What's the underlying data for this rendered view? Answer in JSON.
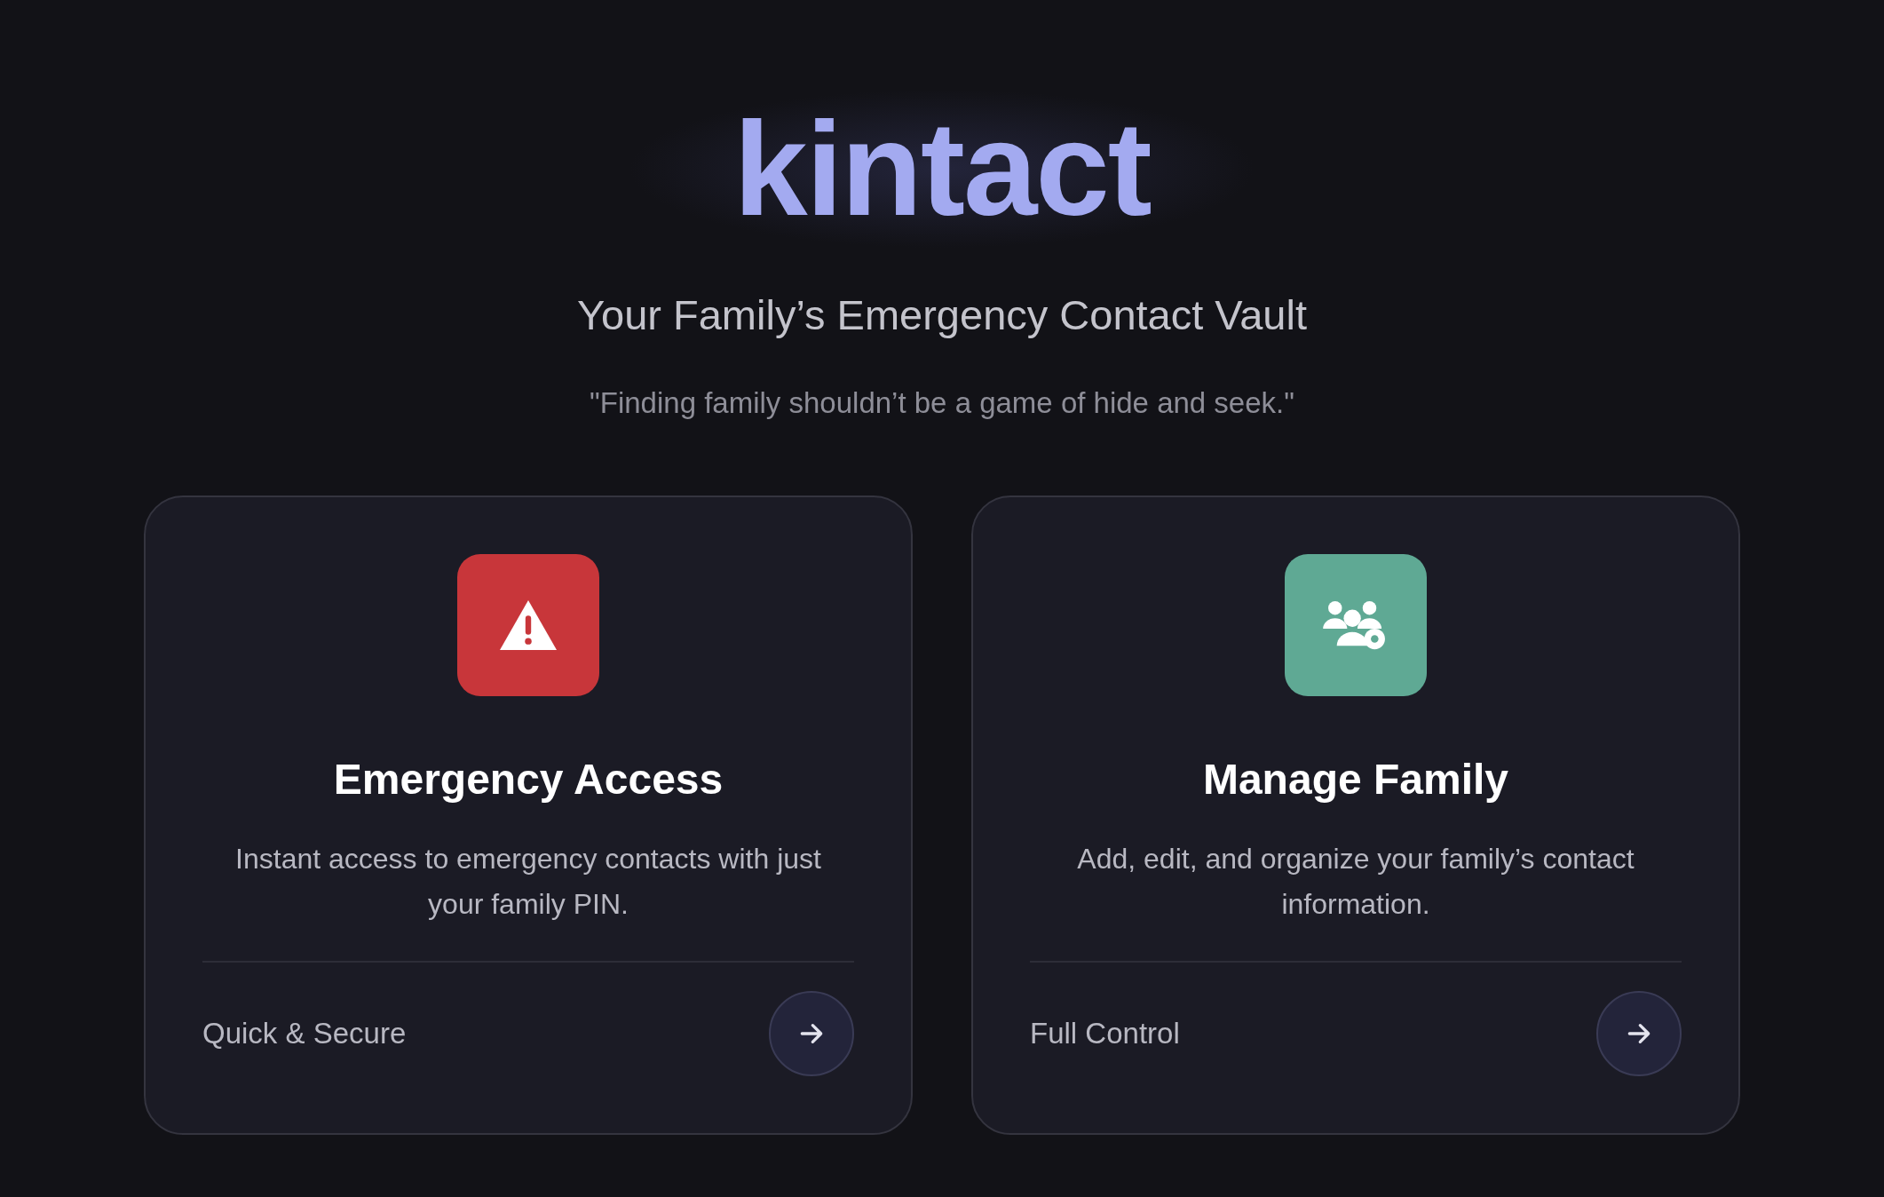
{
  "logo": {
    "text": "kintact"
  },
  "tagline": "Your Family’s Emergency Contact Vault",
  "quote": "\"Finding family shouldn’t be a game of hide and seek.\"",
  "cards": [
    {
      "kind": "emergency",
      "color": "#c8363a",
      "title": "Emergency Access",
      "description": "Instant access to emergency contacts with just your family PIN.",
      "footer": "Quick & Secure"
    },
    {
      "kind": "family",
      "color": "#5fa994",
      "title": "Manage Family",
      "description": "Add, edit, and organize your family’s contact information.",
      "footer": "Full Control"
    }
  ]
}
